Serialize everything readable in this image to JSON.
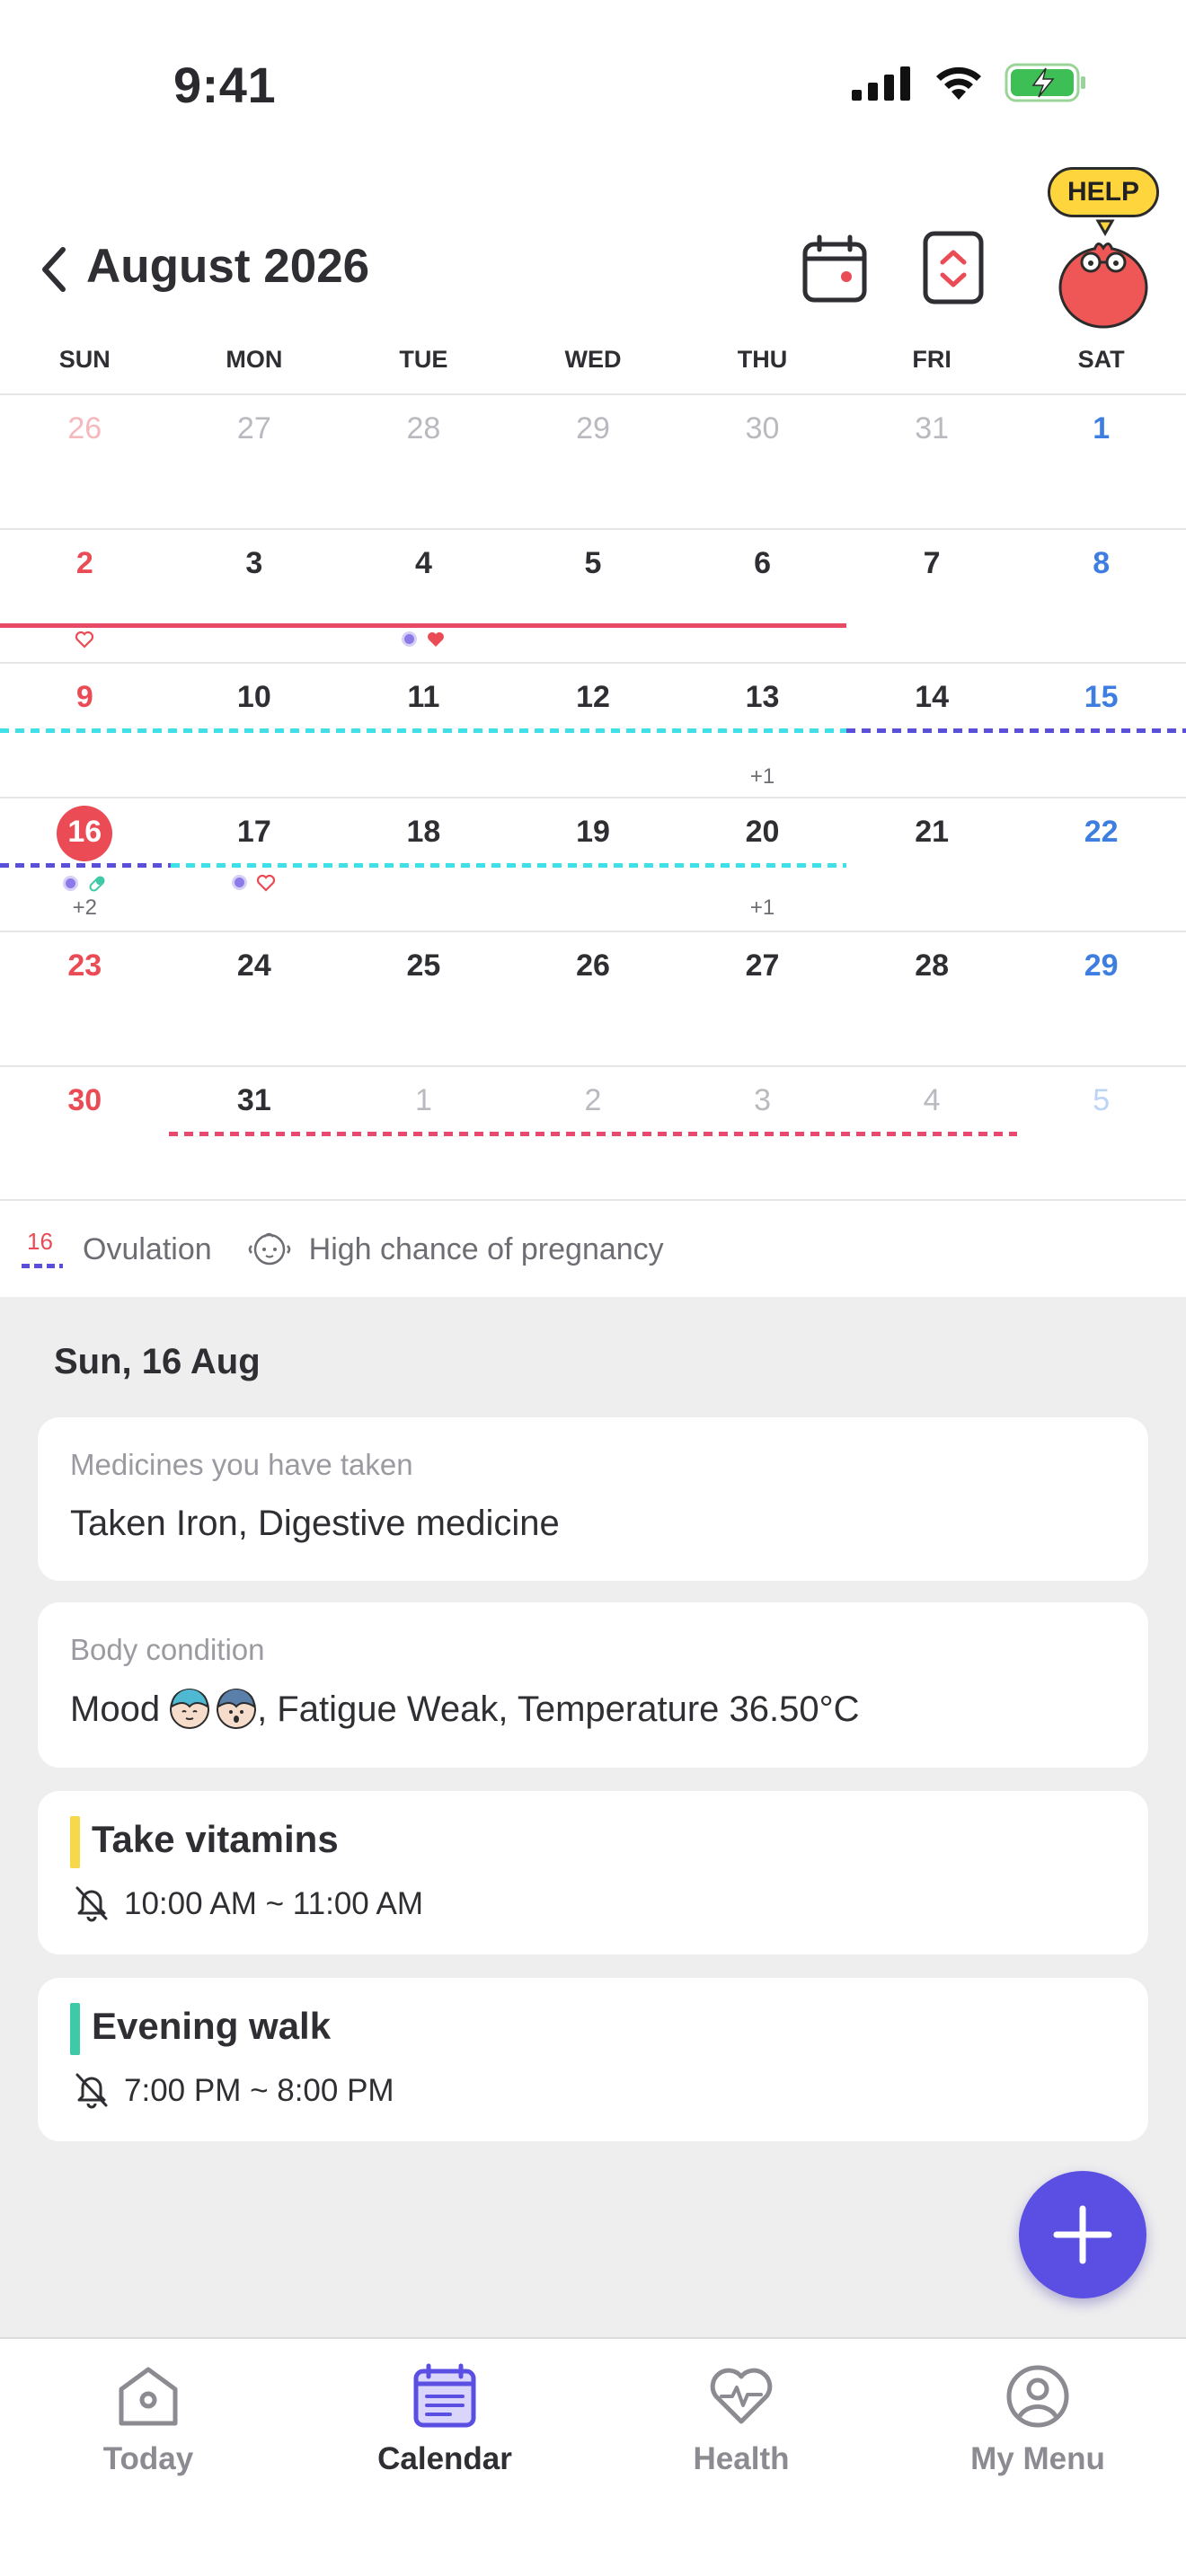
{
  "status_bar": {
    "time": "9:41"
  },
  "header": {
    "title": "August 2026",
    "help_label": "HELP"
  },
  "weekdays": [
    "SUN",
    "MON",
    "TUE",
    "WED",
    "THU",
    "FRI",
    "SAT"
  ],
  "calendar": {
    "weeks": [
      [
        "26",
        "27",
        "28",
        "29",
        "30",
        "31",
        "1"
      ],
      [
        "2",
        "3",
        "4",
        "5",
        "6",
        "7",
        "8"
      ],
      [
        "9",
        "10",
        "11",
        "12",
        "13",
        "14",
        "15"
      ],
      [
        "16",
        "17",
        "18",
        "19",
        "20",
        "21",
        "22"
      ],
      [
        "23",
        "24",
        "25",
        "26",
        "27",
        "28",
        "29"
      ],
      [
        "30",
        "31",
        "1",
        "2",
        "3",
        "4",
        "5"
      ]
    ],
    "more_counts": {
      "w2_thu": "+1",
      "w3_sun": "+2",
      "w3_thu": "+1"
    }
  },
  "legend": {
    "ovulation_day": "16",
    "ovulation": "Ovulation",
    "pregnancy": "High chance of pregnancy"
  },
  "detail": {
    "date": "Sun, 16 Aug",
    "medicines": {
      "label": "Medicines you have taken",
      "value": "Taken Iron, Digestive medicine"
    },
    "body": {
      "label": "Body condition",
      "mood_prefix": "Mood",
      "value_suffix": ", Fatigue Weak, Temperature 36.50°C"
    },
    "events": [
      {
        "title": "Take vitamins",
        "time": "10:00 AM ~ 11:00 AM",
        "color": "#f7d84a"
      },
      {
        "title": "Evening walk",
        "time": "7:00 PM ~ 8:00 PM",
        "color": "#3ec9a7"
      }
    ]
  },
  "tabs": [
    {
      "label": "Today",
      "icon": "home-icon"
    },
    {
      "label": "Calendar",
      "icon": "calendar-icon"
    },
    {
      "label": "Health",
      "icon": "heart-pulse-icon"
    },
    {
      "label": "My Menu",
      "icon": "profile-icon"
    }
  ],
  "colors": {
    "accent": "#5b4fe3",
    "sunday": "#ea4b55",
    "saturday": "#3d7ee0",
    "period": "#e84a65",
    "fertile": "#3fe0e8",
    "ovulation": "#5a4fd8"
  }
}
